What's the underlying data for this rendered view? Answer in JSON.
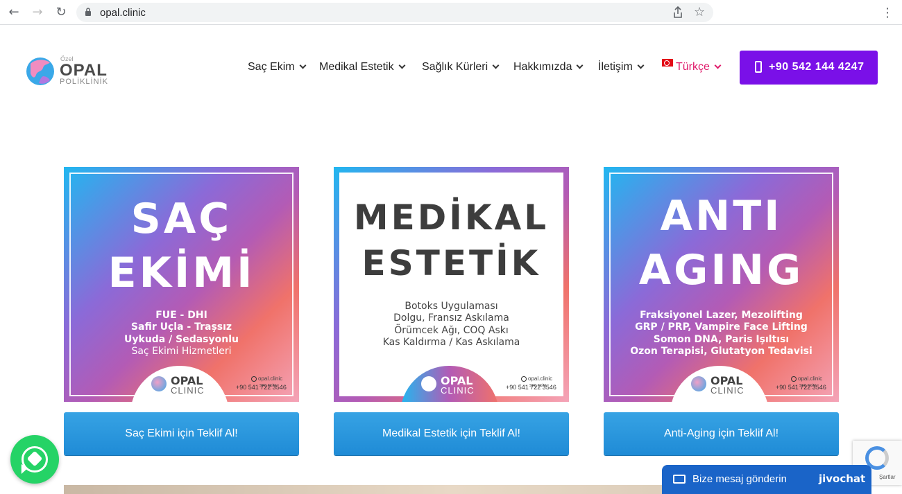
{
  "browser": {
    "url": "opal.clinic",
    "back_icon": "←",
    "forward_icon": "→",
    "reload_icon": "↻",
    "star_icon": "☆",
    "menu_icon": "⋮"
  },
  "logo": {
    "ozel": "Özel",
    "opal": "OPAL",
    "poliklinik": "POLİKLİNİK"
  },
  "nav": {
    "items": [
      {
        "label": "Saç Ekim"
      },
      {
        "label": "Medikal Estetik"
      },
      {
        "label": "Sağlık Kürleri"
      },
      {
        "label": "Hakkımızda"
      },
      {
        "label": "İletişim"
      }
    ],
    "language": "Türkçe",
    "phone": "+90 542 144 4247"
  },
  "colors": {
    "accent_purple": "#7a10e8",
    "cta_blue": "#2796dd",
    "language_pink": "#e01b6b",
    "whatsapp_green": "#25d366",
    "chat_blue": "#1a64c8"
  },
  "cards": [
    {
      "title_line1": "SAÇ",
      "title_line2": "EKİMİ",
      "lines": [
        "FUE - DHI",
        "Safir Uçla - Traşsız",
        "Uykuda / Sedasyonlu",
        "Saç Ekimi Hizmetleri"
      ],
      "badge_line1": "OPAL",
      "badge_line2": "CLINIC",
      "handle": "opal.clinic",
      "handle_sub": "SAÇ EKİM",
      "tel": "+90 541 722 3546",
      "cta": "Saç Ekimi için Teklif Al!"
    },
    {
      "title_line1": "MEDİKAL",
      "title_line2": "ESTETİK",
      "lines": [
        "Botoks Uygulaması",
        "Dolgu, Fransız Askılama",
        "Örümcek Ağı, COQ Askı",
        "Kas Kaldırma / Kas Askılama"
      ],
      "badge_line1": "OPAL",
      "badge_line2": "CLINIC",
      "handle": "opal.clinic",
      "handle_sub": "SAÇ EKİM",
      "tel": "+90 541 722 3546",
      "cta": "Medikal Estetik için Teklif Al!"
    },
    {
      "title_line1": "ANTI",
      "title_line2": "AGING",
      "lines": [
        "Fraksiyonel Lazer, Mezolifting",
        "GRP / PRP, Vampire Face Lifting",
        "Somon DNA, Paris Işıltısı",
        "Ozon Terapisi, Glutatyon Tedavisi"
      ],
      "badge_line1": "OPAL",
      "badge_line2": "CLINIC",
      "handle": "opal.clinic",
      "handle_sub": "SAÇ EKİM",
      "tel": "+90 541 722 3546",
      "cta": "Anti-Aging için Teklif Al!"
    }
  ],
  "chat": {
    "message": "Bize mesaj gönderin",
    "brand": "jivochat"
  },
  "recaptcha": {
    "terms": "Şartlar"
  }
}
